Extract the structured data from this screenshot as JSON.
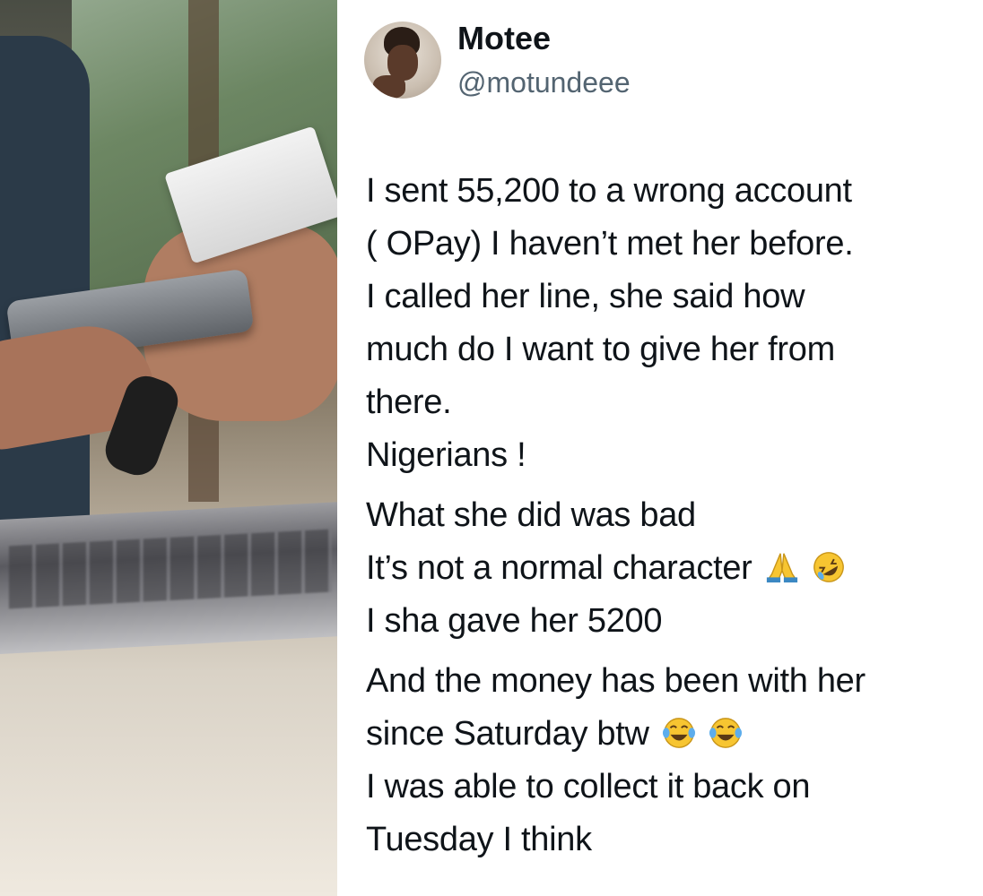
{
  "tweet": {
    "author_name": "Motee",
    "author_handle": "@motundeee",
    "lines": [
      "I sent 55,200 to a wrong account",
      "( OPay) I haven’t met her before.",
      "I called her line, she said how",
      "much do I want to give her from",
      "there.",
      "Nigerians !",
      "What she did was bad",
      "It’s not a normal character",
      "I sha gave her 5200",
      "And the money has been with her",
      "since Saturday btw",
      "I was able to collect it back on",
      "Tuesday I think"
    ],
    "emoji_line_8": [
      "pray-emoji",
      "rofl-emoji"
    ],
    "emoji_line_11": [
      "tears-of-joy-emoji",
      "tears-of-joy-emoji"
    ]
  },
  "colors": {
    "text": "#0f1419",
    "muted": "#536471",
    "emoji_yellow": "#f7c531"
  }
}
